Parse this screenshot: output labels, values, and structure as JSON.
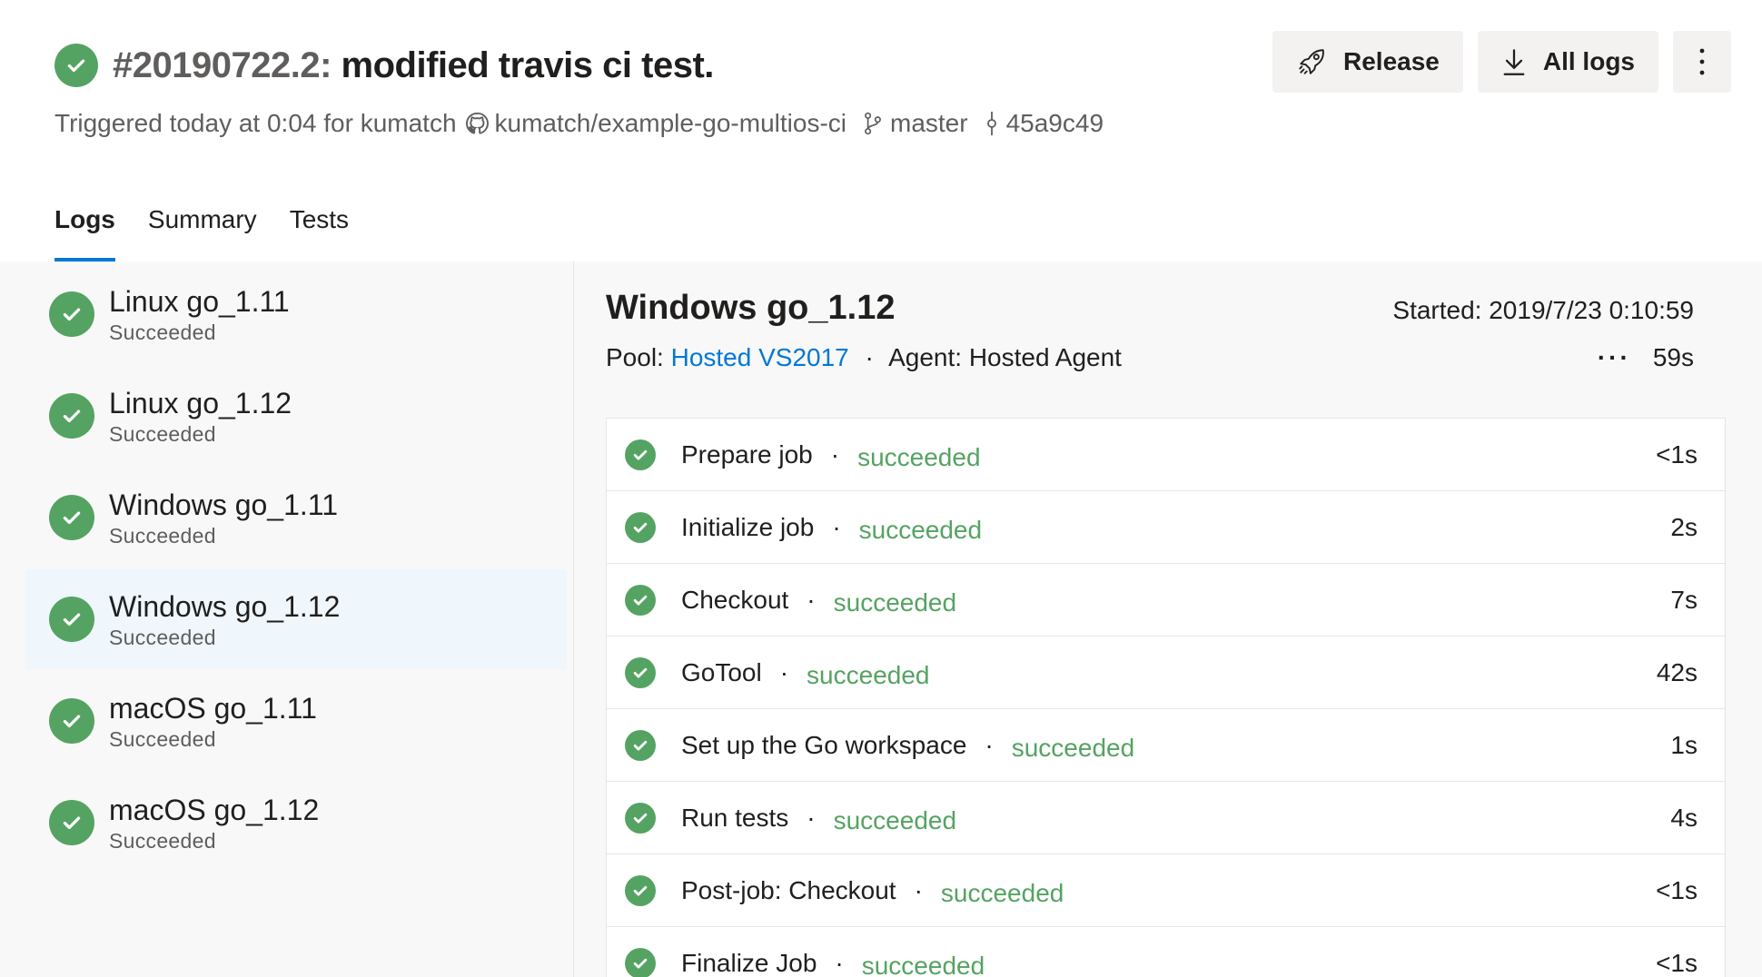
{
  "header": {
    "run_id": "#20190722.2:",
    "run_message": "modified travis ci test.",
    "triggered": "Triggered today at 0:04 for kumatch",
    "repo": "kumatch/example-go-multios-ci",
    "branch": "master",
    "commit": "45a9c49"
  },
  "actions": {
    "release_label": "Release",
    "all_logs_label": "All logs"
  },
  "tabs": [
    {
      "label": "Logs",
      "active": true
    },
    {
      "label": "Summary",
      "active": false
    },
    {
      "label": "Tests",
      "active": false
    }
  ],
  "jobs": [
    {
      "name": "Linux go_1.11",
      "status": "Succeeded"
    },
    {
      "name": "Linux go_1.12",
      "status": "Succeeded"
    },
    {
      "name": "Windows go_1.11",
      "status": "Succeeded"
    },
    {
      "name": "Windows go_1.12",
      "status": "Succeeded",
      "selected": true
    },
    {
      "name": "macOS go_1.11",
      "status": "Succeeded"
    },
    {
      "name": "macOS go_1.12",
      "status": "Succeeded"
    }
  ],
  "detail": {
    "title": "Windows go_1.12",
    "started": "Started: 2019/7/23 0:10:59",
    "pool_label": "Pool:",
    "pool_link": "Hosted VS2017",
    "agent": "Agent: Hosted Agent",
    "more_dots": "···",
    "duration": "59s"
  },
  "steps": [
    {
      "name": "Prepare job",
      "status": "succeeded",
      "duration": "<1s"
    },
    {
      "name": "Initialize job",
      "status": "succeeded",
      "duration": "2s"
    },
    {
      "name": "Checkout",
      "status": "succeeded",
      "duration": "7s"
    },
    {
      "name": "GoTool",
      "status": "succeeded",
      "duration": "42s"
    },
    {
      "name": "Set up the Go workspace",
      "status": "succeeded",
      "duration": "1s"
    },
    {
      "name": "Run tests",
      "status": "succeeded",
      "duration": "4s"
    },
    {
      "name": "Post-job: Checkout",
      "status": "succeeded",
      "duration": "<1s"
    },
    {
      "name": "Finalize Job",
      "status": "succeeded",
      "duration": "<1s"
    }
  ],
  "colors": {
    "success_green": "#55a362",
    "accent_blue": "#0078d4",
    "selected_bg": "#eff6fc",
    "pane_bg": "#f8f8f8"
  },
  "icons": [
    "check-circle-icon",
    "github-icon",
    "branch-icon",
    "commit-icon",
    "rocket-icon",
    "download-icon",
    "more-vertical-icon"
  ]
}
